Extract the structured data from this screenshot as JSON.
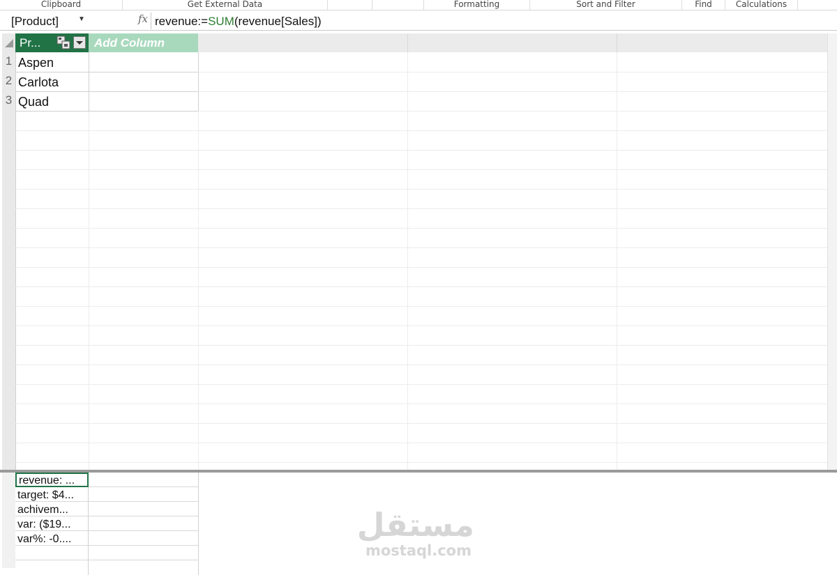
{
  "ribbon": {
    "groups": [
      "Clipboard",
      "Get External Data",
      "",
      "",
      "Formatting",
      "Sort and Filter",
      "Find",
      "Calculations",
      ""
    ]
  },
  "formula_bar": {
    "name_box": "[Product]",
    "fx": "fx",
    "formula_prefix": "revenue:=",
    "formula_function": "SUM",
    "formula_args": "(revenue[Sales])"
  },
  "grid": {
    "columns": [
      {
        "label": "Pr...",
        "selected": true
      },
      {
        "label": "Add Column",
        "placeholder": true
      }
    ],
    "rows": [
      {
        "num": "1",
        "product": "Aspen"
      },
      {
        "num": "2",
        "product": "Carlota"
      },
      {
        "num": "3",
        "product": "Quad"
      }
    ]
  },
  "calculation_area": {
    "measures": [
      "revenue: ...",
      "target: $4...",
      "achivem...",
      "var: ($19...",
      "var%: -0...."
    ]
  },
  "watermark": {
    "arabic": "مستقل",
    "latin": "mostaql.com"
  },
  "colors": {
    "selected_header": "#217346",
    "add_column_header": "#a9d9bd",
    "formula_function": "#2e7d32"
  }
}
